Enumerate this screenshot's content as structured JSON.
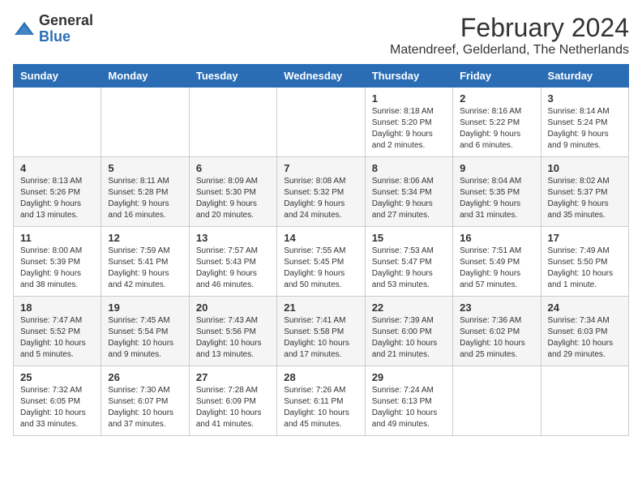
{
  "logo": {
    "text_general": "General",
    "text_blue": "Blue"
  },
  "title": "February 2024",
  "subtitle": "Matendreef, Gelderland, The Netherlands",
  "weekdays": [
    "Sunday",
    "Monday",
    "Tuesday",
    "Wednesday",
    "Thursday",
    "Friday",
    "Saturday"
  ],
  "weeks": [
    [
      {
        "day": "",
        "info": ""
      },
      {
        "day": "",
        "info": ""
      },
      {
        "day": "",
        "info": ""
      },
      {
        "day": "",
        "info": ""
      },
      {
        "day": "1",
        "info": "Sunrise: 8:18 AM\nSunset: 5:20 PM\nDaylight: 9 hours\nand 2 minutes."
      },
      {
        "day": "2",
        "info": "Sunrise: 8:16 AM\nSunset: 5:22 PM\nDaylight: 9 hours\nand 6 minutes."
      },
      {
        "day": "3",
        "info": "Sunrise: 8:14 AM\nSunset: 5:24 PM\nDaylight: 9 hours\nand 9 minutes."
      }
    ],
    [
      {
        "day": "4",
        "info": "Sunrise: 8:13 AM\nSunset: 5:26 PM\nDaylight: 9 hours\nand 13 minutes."
      },
      {
        "day": "5",
        "info": "Sunrise: 8:11 AM\nSunset: 5:28 PM\nDaylight: 9 hours\nand 16 minutes."
      },
      {
        "day": "6",
        "info": "Sunrise: 8:09 AM\nSunset: 5:30 PM\nDaylight: 9 hours\nand 20 minutes."
      },
      {
        "day": "7",
        "info": "Sunrise: 8:08 AM\nSunset: 5:32 PM\nDaylight: 9 hours\nand 24 minutes."
      },
      {
        "day": "8",
        "info": "Sunrise: 8:06 AM\nSunset: 5:34 PM\nDaylight: 9 hours\nand 27 minutes."
      },
      {
        "day": "9",
        "info": "Sunrise: 8:04 AM\nSunset: 5:35 PM\nDaylight: 9 hours\nand 31 minutes."
      },
      {
        "day": "10",
        "info": "Sunrise: 8:02 AM\nSunset: 5:37 PM\nDaylight: 9 hours\nand 35 minutes."
      }
    ],
    [
      {
        "day": "11",
        "info": "Sunrise: 8:00 AM\nSunset: 5:39 PM\nDaylight: 9 hours\nand 38 minutes."
      },
      {
        "day": "12",
        "info": "Sunrise: 7:59 AM\nSunset: 5:41 PM\nDaylight: 9 hours\nand 42 minutes."
      },
      {
        "day": "13",
        "info": "Sunrise: 7:57 AM\nSunset: 5:43 PM\nDaylight: 9 hours\nand 46 minutes."
      },
      {
        "day": "14",
        "info": "Sunrise: 7:55 AM\nSunset: 5:45 PM\nDaylight: 9 hours\nand 50 minutes."
      },
      {
        "day": "15",
        "info": "Sunrise: 7:53 AM\nSunset: 5:47 PM\nDaylight: 9 hours\nand 53 minutes."
      },
      {
        "day": "16",
        "info": "Sunrise: 7:51 AM\nSunset: 5:49 PM\nDaylight: 9 hours\nand 57 minutes."
      },
      {
        "day": "17",
        "info": "Sunrise: 7:49 AM\nSunset: 5:50 PM\nDaylight: 10 hours\nand 1 minute."
      }
    ],
    [
      {
        "day": "18",
        "info": "Sunrise: 7:47 AM\nSunset: 5:52 PM\nDaylight: 10 hours\nand 5 minutes."
      },
      {
        "day": "19",
        "info": "Sunrise: 7:45 AM\nSunset: 5:54 PM\nDaylight: 10 hours\nand 9 minutes."
      },
      {
        "day": "20",
        "info": "Sunrise: 7:43 AM\nSunset: 5:56 PM\nDaylight: 10 hours\nand 13 minutes."
      },
      {
        "day": "21",
        "info": "Sunrise: 7:41 AM\nSunset: 5:58 PM\nDaylight: 10 hours\nand 17 minutes."
      },
      {
        "day": "22",
        "info": "Sunrise: 7:39 AM\nSunset: 6:00 PM\nDaylight: 10 hours\nand 21 minutes."
      },
      {
        "day": "23",
        "info": "Sunrise: 7:36 AM\nSunset: 6:02 PM\nDaylight: 10 hours\nand 25 minutes."
      },
      {
        "day": "24",
        "info": "Sunrise: 7:34 AM\nSunset: 6:03 PM\nDaylight: 10 hours\nand 29 minutes."
      }
    ],
    [
      {
        "day": "25",
        "info": "Sunrise: 7:32 AM\nSunset: 6:05 PM\nDaylight: 10 hours\nand 33 minutes."
      },
      {
        "day": "26",
        "info": "Sunrise: 7:30 AM\nSunset: 6:07 PM\nDaylight: 10 hours\nand 37 minutes."
      },
      {
        "day": "27",
        "info": "Sunrise: 7:28 AM\nSunset: 6:09 PM\nDaylight: 10 hours\nand 41 minutes."
      },
      {
        "day": "28",
        "info": "Sunrise: 7:26 AM\nSunset: 6:11 PM\nDaylight: 10 hours\nand 45 minutes."
      },
      {
        "day": "29",
        "info": "Sunrise: 7:24 AM\nSunset: 6:13 PM\nDaylight: 10 hours\nand 49 minutes."
      },
      {
        "day": "",
        "info": ""
      },
      {
        "day": "",
        "info": ""
      }
    ]
  ]
}
